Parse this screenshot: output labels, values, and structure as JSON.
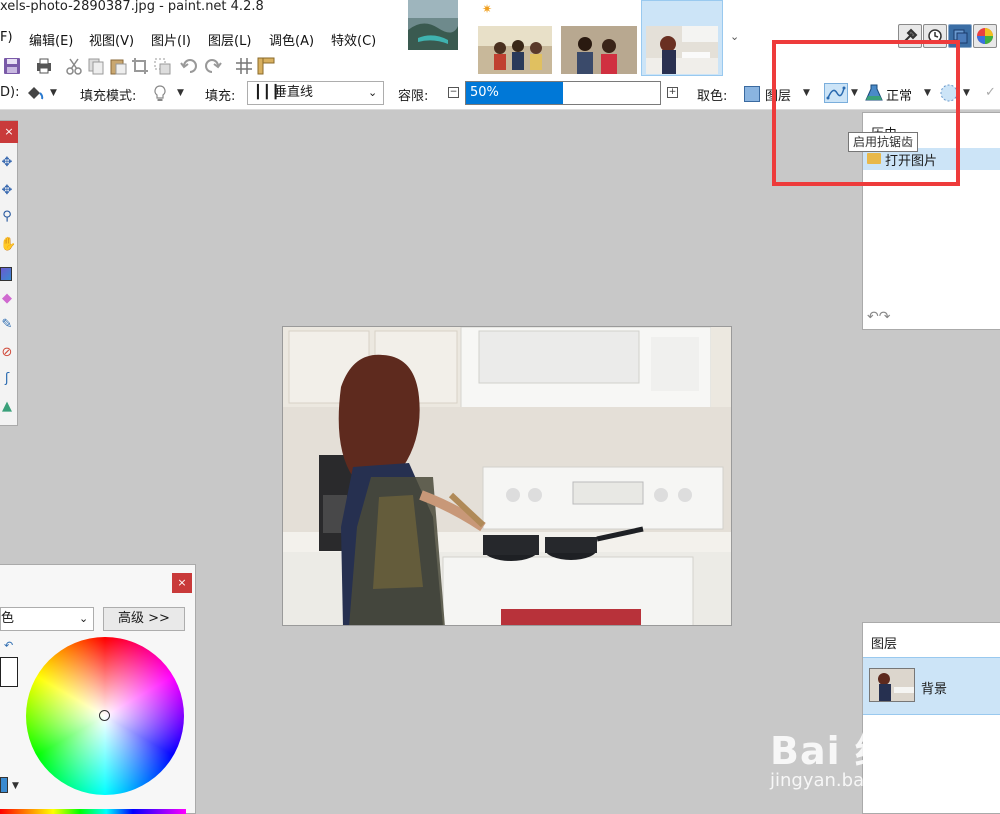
{
  "window": {
    "title": "xels-photo-2890387.jpg - paint.net 4.2.8"
  },
  "menu": [
    "F)",
    "编辑(E)",
    "视图(V)",
    "图片(I)",
    "图层(L)",
    "调色(A)",
    "特效(C)"
  ],
  "toolbar2": {
    "antialias_partial": "D):",
    "fill_mode_label": "填充模式:",
    "fill_label": "填充:",
    "fill_value": "垂直线",
    "tolerance_label": "容限:",
    "tolerance_value": "50%",
    "tolerance_fraction": 0.5,
    "sampling_label": "取色:",
    "sampling_value": "图层",
    "blend_value": "正常"
  },
  "tooltip": "启用抗锯齿",
  "history": {
    "title": "历史",
    "items": [
      "打开图片"
    ]
  },
  "layers": {
    "title": "图层",
    "items": [
      "背景"
    ]
  },
  "colors": {
    "mode_value": "色",
    "advanced_label": "高级 >>"
  },
  "watermark": {
    "logo": "Bai 经验",
    "url": "jingyan.baidu.com"
  },
  "accent": "#0078d7",
  "highlight_color": "#ee3b3b",
  "icons": [
    "save-icon",
    "print-icon",
    "cut-icon",
    "copy-icon",
    "paste-icon",
    "crop-icon",
    "deselect-icon",
    "undo-icon",
    "redo-icon",
    "grid-icon",
    "ruler-icon"
  ]
}
